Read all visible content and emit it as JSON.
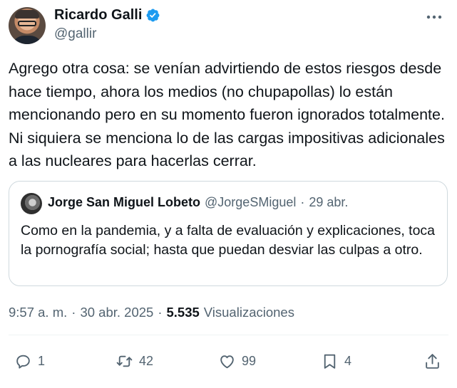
{
  "author": {
    "name": "Ricardo Galli",
    "handle": "@gallir"
  },
  "tweet": {
    "text": "Agrego otra cosa: se venían advirtiendo de estos riesgos desde hace tiempo, ahora los medios (no chupapollas) lo están mencionando pero en su momento fueron ignorados totalmente. Ni siquiera se menciona lo de  las cargas impositivas adicionales a las nucleares para hacerlas cerrar."
  },
  "quote": {
    "name": "Jorge San Miguel Lobeto",
    "handle": "@JorgeSMiguel",
    "separator": "·",
    "date": "29 abr.",
    "text": "Como en la pandemia, y a falta de evaluación y explicaciones, toca la pornografía social; hasta que puedan desviar las culpas a otro."
  },
  "meta": {
    "time": "9:57 a. m.",
    "separator1": "·",
    "date": "30 abr. 2025",
    "separator2": "·",
    "views_count": "5.535",
    "views_label": "Visualizaciones"
  },
  "actions": {
    "replies": "1",
    "reposts": "42",
    "likes": "99",
    "bookmarks": "4"
  },
  "colors": {
    "verified": "#1d9bf0",
    "text": "#0f1419",
    "secondary": "#536471",
    "border": "#cfd9de"
  },
  "icons": {
    "verified": "verified-badge-icon",
    "more": "more-options-icon",
    "reply": "reply-icon",
    "retweet": "retweet-icon",
    "like": "heart-icon",
    "bookmark": "bookmark-icon",
    "share": "share-icon"
  }
}
